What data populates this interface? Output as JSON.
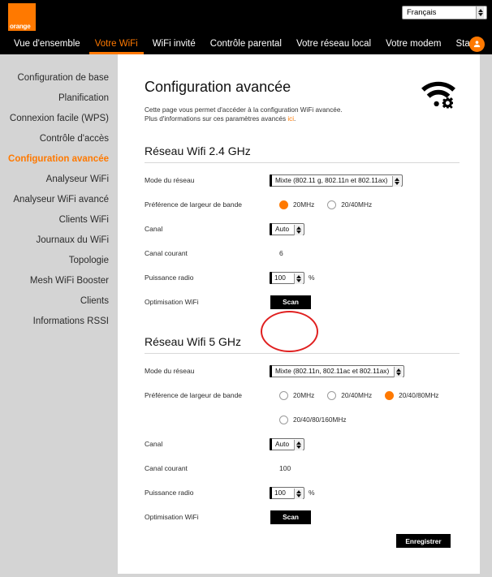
{
  "header": {
    "logo_text": "orange",
    "language_value": "Français",
    "avatar_icon": "user-icon"
  },
  "nav": {
    "items": [
      {
        "label": "Vue d'ensemble",
        "active": false
      },
      {
        "label": "Votre WiFi",
        "active": true
      },
      {
        "label": "WiFi invité",
        "active": false
      },
      {
        "label": "Contrôle parental",
        "active": false
      },
      {
        "label": "Votre réseau local",
        "active": false
      },
      {
        "label": "Votre modem",
        "active": false
      },
      {
        "label": "Statut",
        "active": false
      }
    ]
  },
  "sidebar": {
    "items": [
      {
        "label": "Configuration de base",
        "active": false
      },
      {
        "label": "Planification",
        "active": false
      },
      {
        "label": "Connexion facile (WPS)",
        "active": false
      },
      {
        "label": "Contrôle d'accès",
        "active": false
      },
      {
        "label": "Configuration avancée",
        "active": true
      },
      {
        "label": "Analyseur WiFi",
        "active": false
      },
      {
        "label": "Analyseur WiFi avancé",
        "active": false
      },
      {
        "label": "Clients WiFi",
        "active": false
      },
      {
        "label": "Journaux du WiFi",
        "active": false
      },
      {
        "label": "Topologie",
        "active": false
      },
      {
        "label": "Mesh WiFi Booster",
        "active": false
      },
      {
        "label": "Clients",
        "active": false
      },
      {
        "label": "Informations RSSI",
        "active": false
      }
    ]
  },
  "main": {
    "title": "Configuration avancée",
    "desc_line1": "Cette page vous permet d'accéder à la configuration WiFi avancée.",
    "desc_line2_pre": "Plus d'informations sur ces paramètres avancés ",
    "desc_link": "ici",
    "desc_line2_post": ".",
    "header_icon": "wifi-settings-icon",
    "save_label": "Enregistrer"
  },
  "band24": {
    "section_title": "Réseau Wifi 2.4 GHz",
    "mode_label": "Mode du réseau",
    "mode_value": "Mixte (802.11 g, 802.11n et 802.11ax)",
    "bandwidth_label": "Préférence de largeur de bande",
    "bandwidth_options": [
      {
        "label": "20MHz",
        "selected": true
      },
      {
        "label": "20/40MHz",
        "selected": false
      }
    ],
    "channel_label": "Canal",
    "channel_value": "Auto",
    "current_channel_label": "Canal courant",
    "current_channel_value": "6",
    "power_label": "Puissance radio",
    "power_value": "100",
    "power_unit": "%",
    "optimisation_label": "Optimisation WiFi",
    "scan_label": "Scan"
  },
  "band5": {
    "section_title": "Réseau Wifi 5 GHz",
    "mode_label": "Mode du réseau",
    "mode_value": "Mixte (802.11n, 802.11ac et 802.11ax)",
    "bandwidth_label": "Préférence de largeur de bande",
    "bandwidth_options_row1": [
      {
        "label": "20MHz",
        "selected": false
      },
      {
        "label": "20/40MHz",
        "selected": false
      },
      {
        "label": "20/40/80MHz",
        "selected": true
      }
    ],
    "bandwidth_options_row2": [
      {
        "label": "20/40/80/160MHz",
        "selected": false
      }
    ],
    "channel_label": "Canal",
    "channel_value": "Auto",
    "current_channel_label": "Canal courant",
    "current_channel_value": "100",
    "power_label": "Puissance radio",
    "power_value": "100",
    "power_unit": "%",
    "optimisation_label": "Optimisation WiFi",
    "scan_label": "Scan"
  },
  "annotation": {
    "shape": "red-ellipse-highlight",
    "target": "scan-button-2-4ghz",
    "color": "#e02020"
  },
  "colors": {
    "brand_orange": "#ff7900",
    "nav_black": "#000000",
    "page_gray": "#d4d4d4",
    "panel_white": "#ffffff"
  }
}
